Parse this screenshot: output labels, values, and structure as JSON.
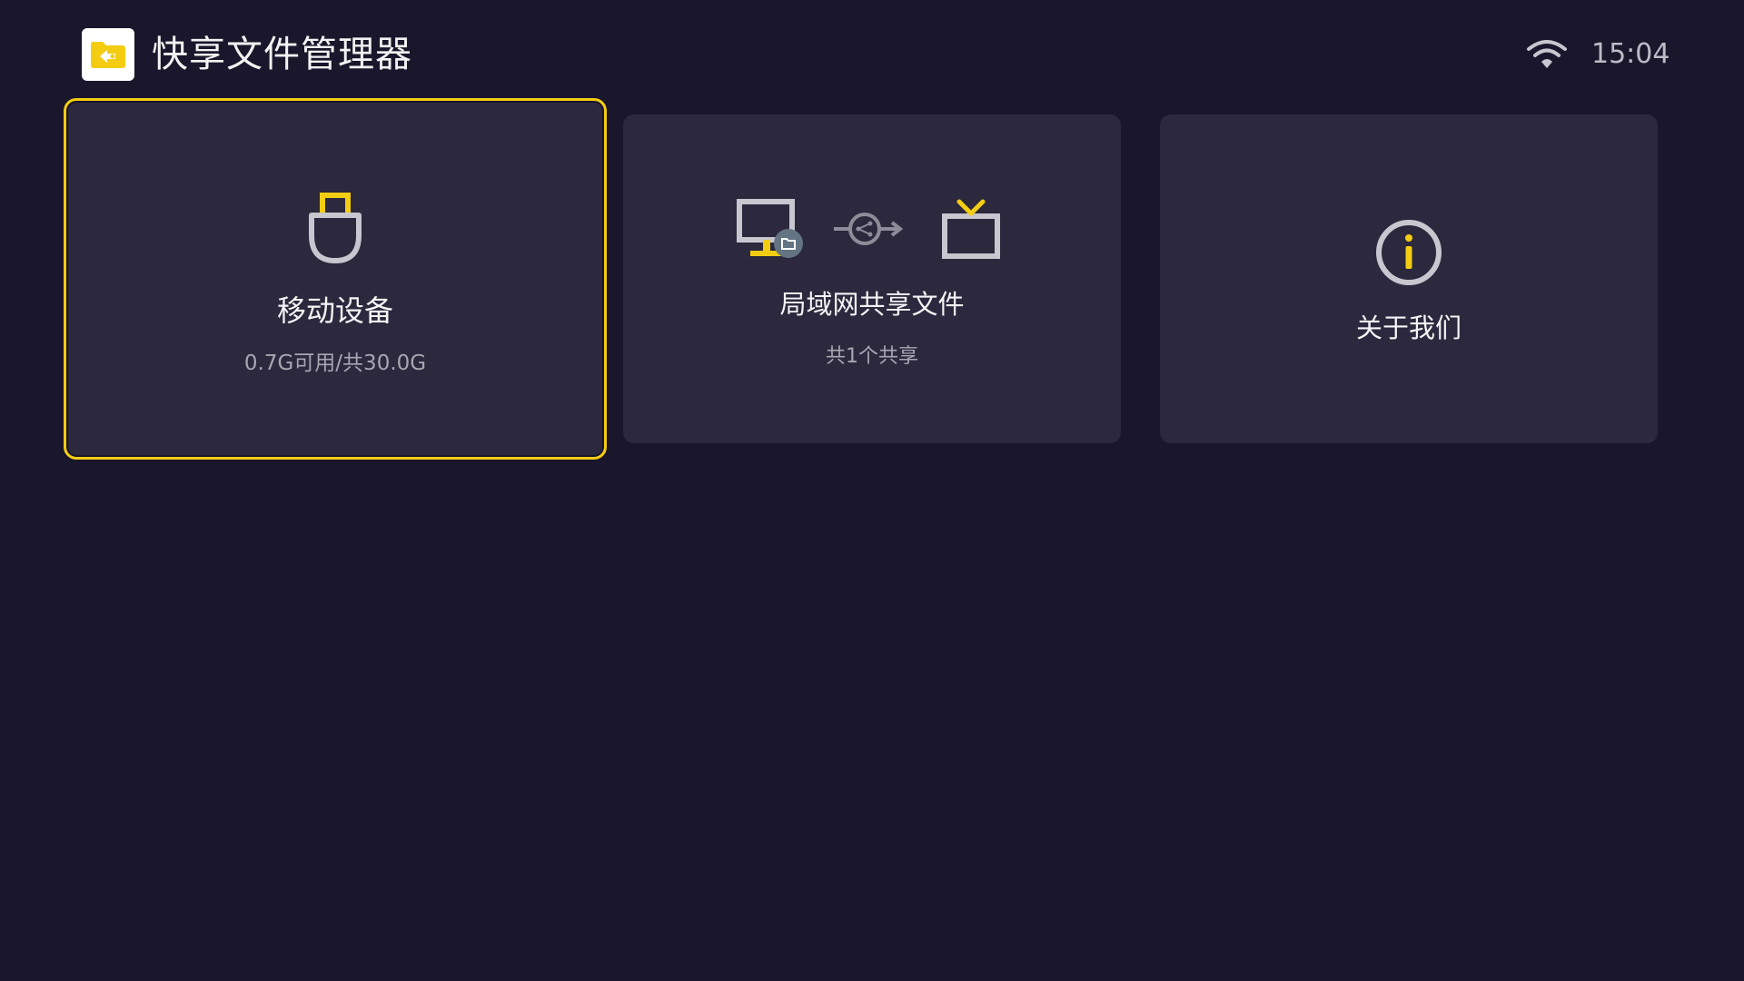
{
  "header": {
    "app_title": "快享文件管理器",
    "logo_icon": "folder-share-logo-icon",
    "status": {
      "wifi_icon": "wifi-icon",
      "time": "15:04"
    }
  },
  "cards": [
    {
      "id": "usb",
      "icon": "usb-drive-icon",
      "label": "移动设备",
      "sub": "0.7G可用/共30.0G",
      "focused": true
    },
    {
      "id": "lan",
      "icon": "pc-to-tv-share-icon",
      "label": "局域网共享文件",
      "sub": "共1个共享",
      "focused": false
    },
    {
      "id": "about",
      "icon": "info-icon",
      "label": "关于我们",
      "focused": false
    }
  ],
  "colors": {
    "background": "#1a162b",
    "card": "#2c283d",
    "accent": "#f4cd12",
    "icon_gray": "#c8c6cf"
  }
}
